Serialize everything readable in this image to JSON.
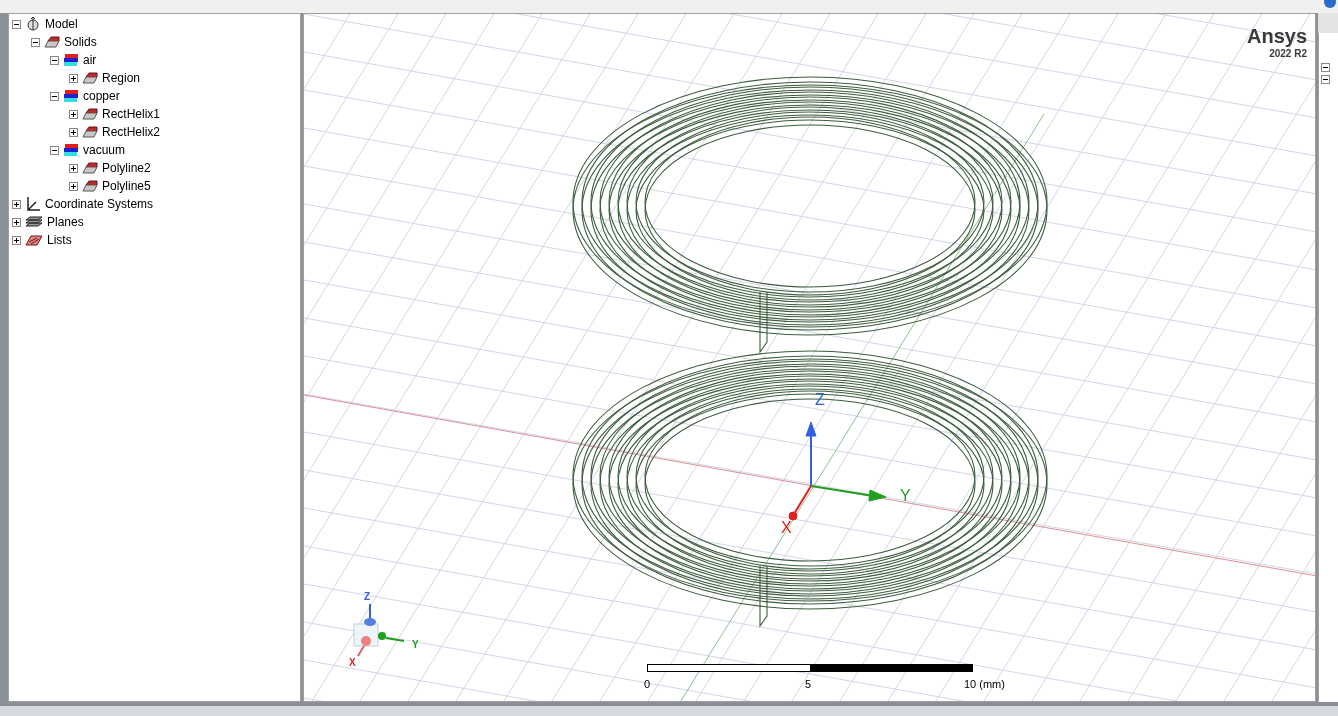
{
  "tree": [
    {
      "label": "Model",
      "kind": "model",
      "expanded": true,
      "children": [
        {
          "label": "Solids",
          "kind": "solid",
          "expanded": true,
          "children": [
            {
              "label": "air",
              "kind": "material",
              "expanded": true,
              "children": [
                {
                  "label": "Region",
                  "kind": "solid",
                  "expanded": false
                }
              ]
            },
            {
              "label": "copper",
              "kind": "material",
              "expanded": true,
              "children": [
                {
                  "label": "RectHelix1",
                  "kind": "solid",
                  "expanded": false
                },
                {
                  "label": "RectHelix2",
                  "kind": "solid",
                  "expanded": false
                }
              ]
            },
            {
              "label": "vacuum",
              "kind": "material",
              "expanded": true,
              "children": [
                {
                  "label": "Polyline2",
                  "kind": "solid",
                  "expanded": false
                },
                {
                  "label": "Polyline5",
                  "kind": "solid",
                  "expanded": false
                }
              ]
            }
          ]
        }
      ]
    },
    {
      "label": "Coordinate Systems",
      "kind": "coordinate",
      "expanded": false
    },
    {
      "label": "Planes",
      "kind": "planes",
      "expanded": false
    },
    {
      "label": "Lists",
      "kind": "lists",
      "expanded": false
    }
  ],
  "viewport": {
    "brand": "Ansys",
    "version": "2022 R2",
    "axes": {
      "z": "Z",
      "y": "Y",
      "x": "X"
    },
    "triad": {
      "z": "Z",
      "y": "Y",
      "x": "X"
    },
    "scale_labels": [
      "0",
      "5",
      "10 (mm)"
    ]
  }
}
